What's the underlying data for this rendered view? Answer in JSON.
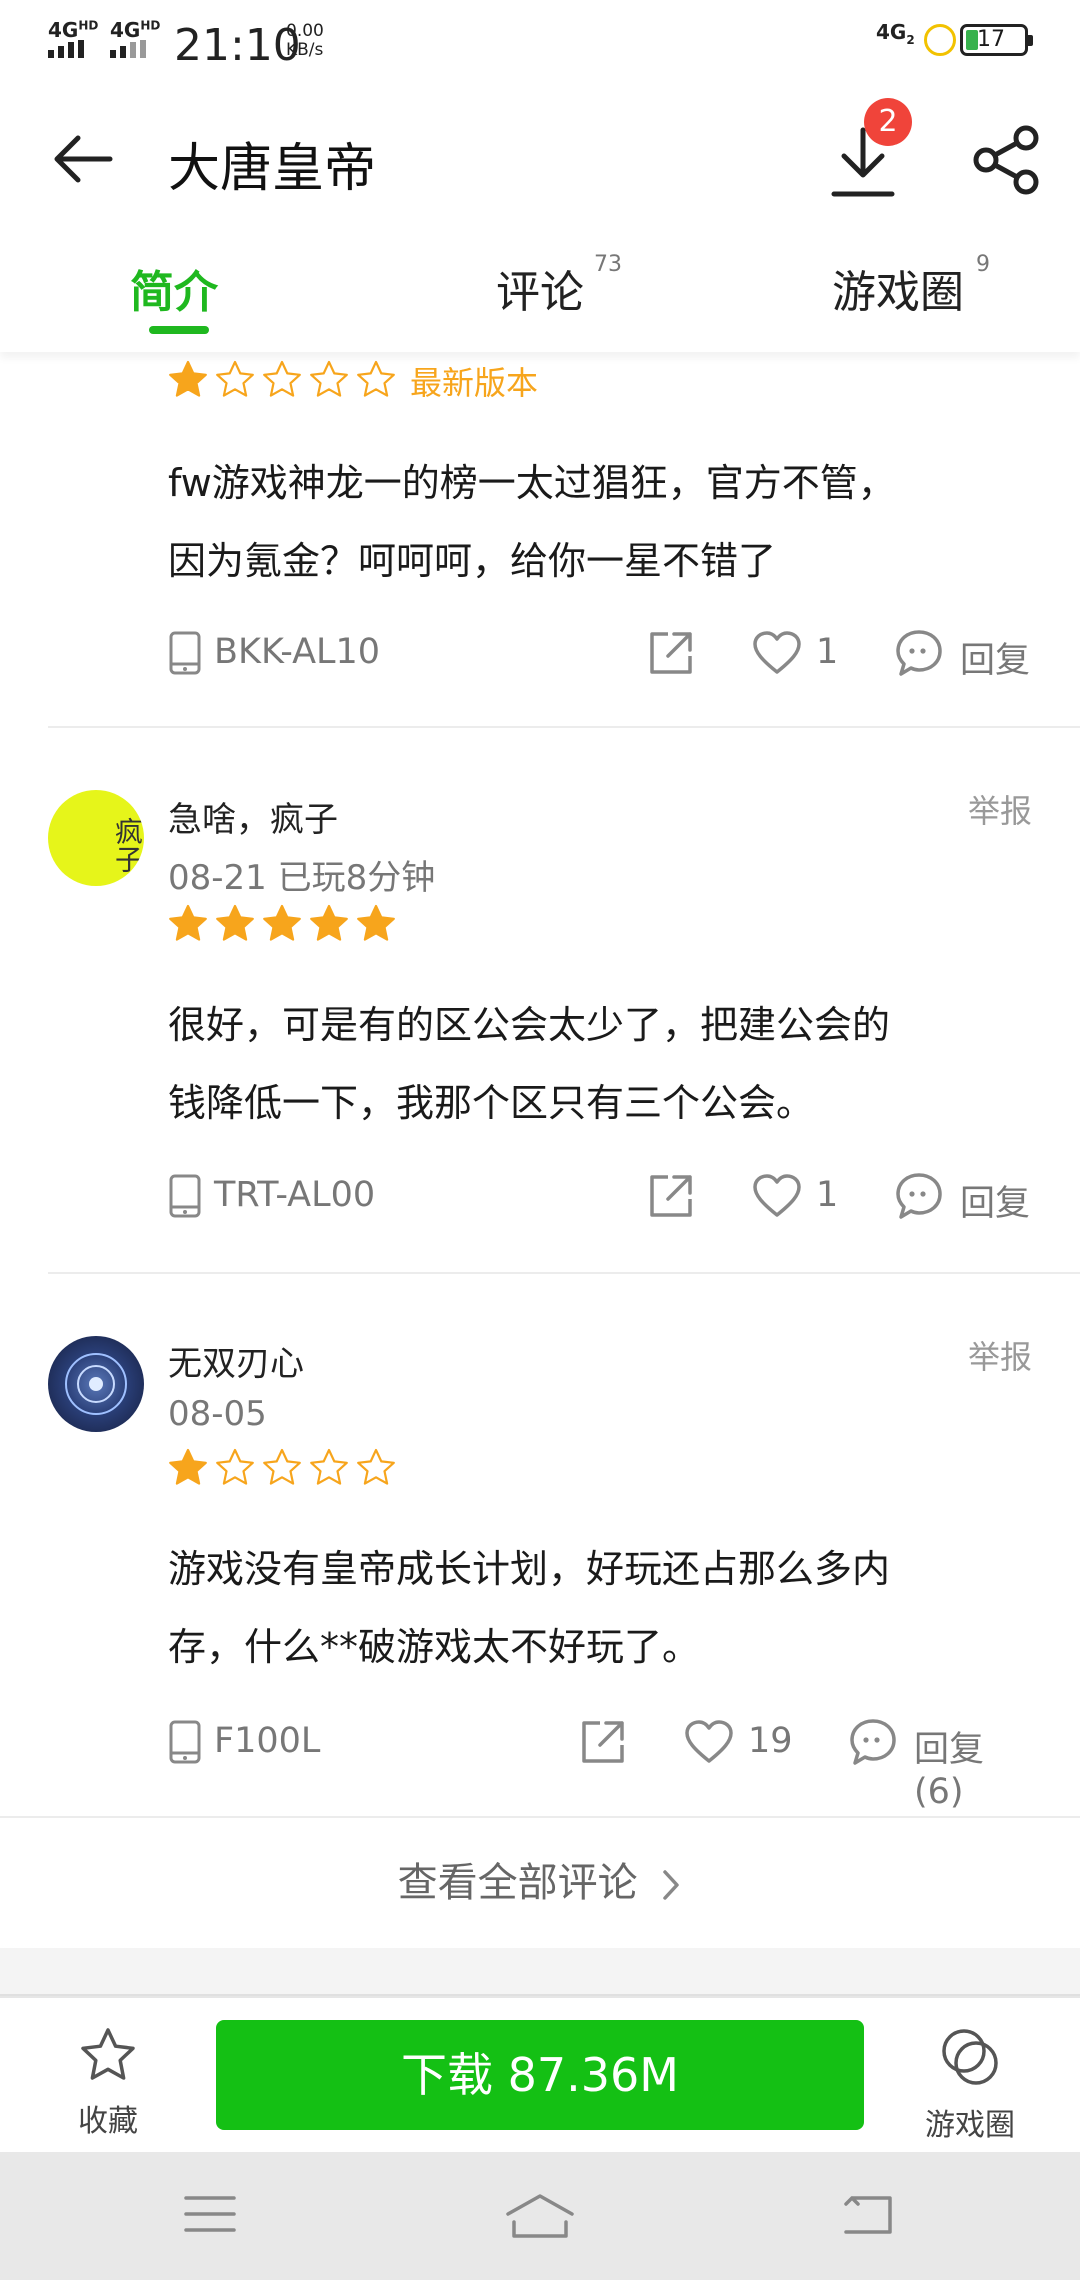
{
  "status_bar": {
    "net1": "4G",
    "net1_sup": "HD",
    "net2": "4G",
    "net2_sup": "HD",
    "time": "21:10",
    "speed_value": "0.00",
    "speed_unit": "KB/s",
    "net_right": "4G",
    "net_right_sub": "2",
    "battery": "17"
  },
  "header": {
    "title": "大唐皇帝",
    "download_badge": "2"
  },
  "tabs": [
    {
      "label": "简介",
      "count": ""
    },
    {
      "label": "评论",
      "count": "73"
    },
    {
      "label": "游戏圈",
      "count": "9"
    }
  ],
  "reviews": [
    {
      "rating": 1,
      "version_tag": "最新版本",
      "text_line1": "fw游戏神龙一的榜一太过猖狂，官方不管，",
      "text_line2": "因为氪金？呵呵呵，给你一星不错了",
      "device": "BKK-AL10",
      "likes": "1",
      "reply_label": "回复"
    },
    {
      "username": "急啥，疯子",
      "avatar_text": "疯子",
      "date_played": "08-21  已玩8分钟",
      "report_label": "举报",
      "rating": 5,
      "text_line1": "很好，可是有的区公会太少了，把建公会的",
      "text_line2": "钱降低一下，我那个区只有三个公会。",
      "device": "TRT-AL00",
      "likes": "1",
      "reply_label": "回复"
    },
    {
      "username": "无双刃心",
      "date_played": "08-05",
      "report_label": "举报",
      "rating": 1,
      "text_line1": "游戏没有皇帝成长计划，好玩还占那么多内",
      "text_line2": "存，什么**破游戏太不好玩了。",
      "device": "F100L",
      "likes": "19",
      "reply_label": "回复(6)"
    }
  ],
  "view_all_label": "查看全部评论",
  "bottom_bar": {
    "favorite_label": "收藏",
    "download_label": "下载 87.36M",
    "circle_label": "游戏圈"
  },
  "colors": {
    "accent_green": "#1fb81f",
    "download_green": "#14c014",
    "star_gold": "#f7a51c",
    "version_tag": "#f7a51c",
    "badge_red": "#f0443a"
  },
  "icons": [
    "back-arrow-icon",
    "download-icon",
    "share-icon",
    "star-icon",
    "device-icon",
    "external-share-icon",
    "heart-icon",
    "comment-icon",
    "chevron-right-icon",
    "game-circle-icon",
    "menu-icon",
    "home-icon",
    "back-icon"
  ]
}
